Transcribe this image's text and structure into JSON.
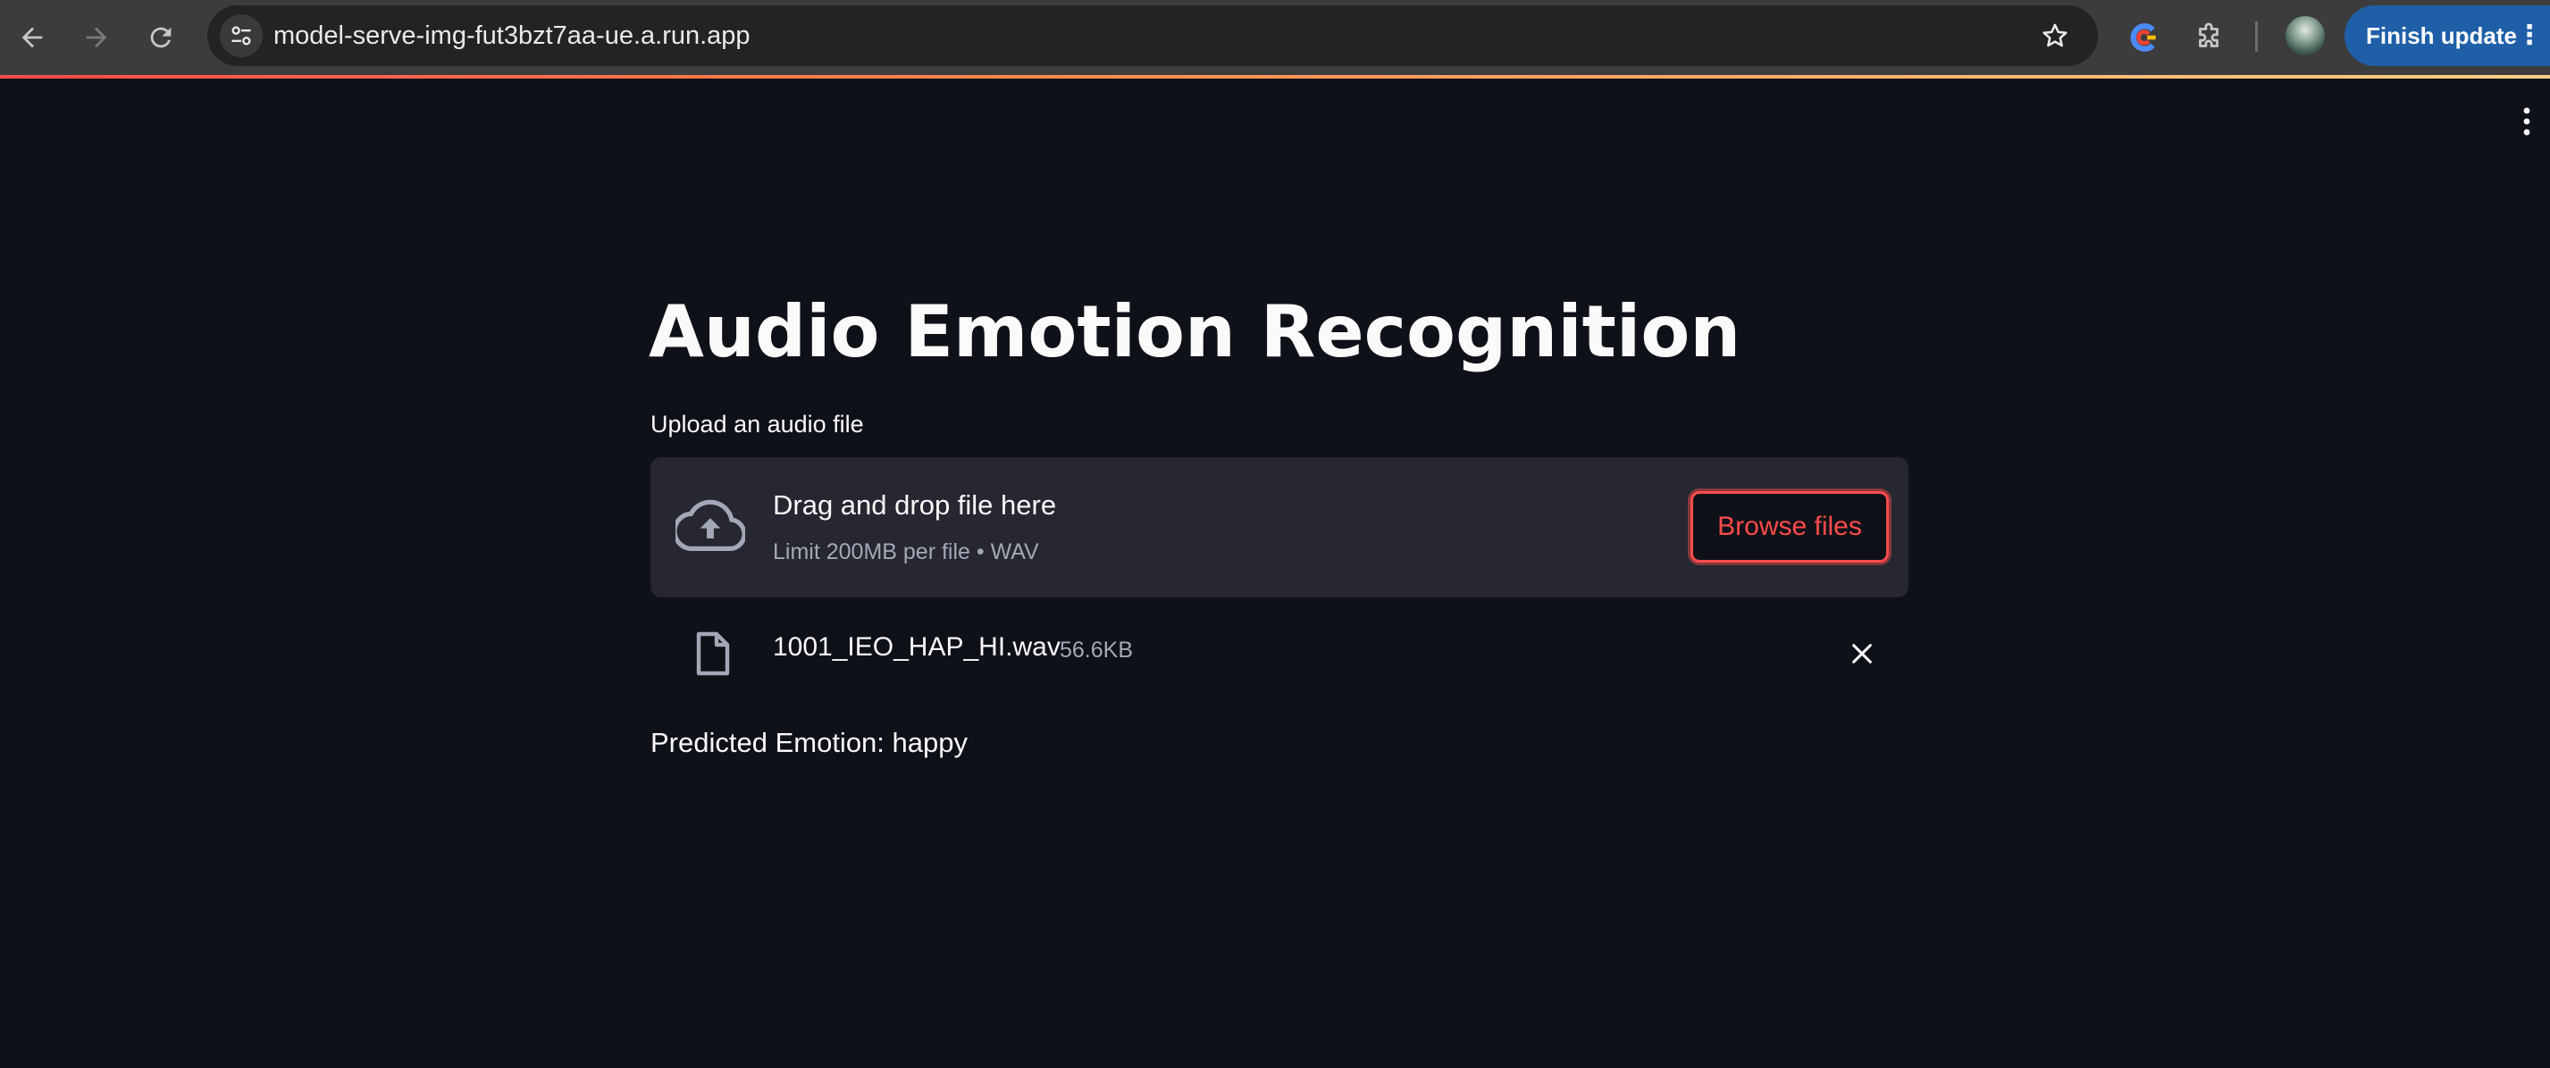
{
  "browser": {
    "url": "model-serve-img-fut3bzt7aa-ue.a.run.app",
    "finish_update_label": "Finish update",
    "icons": {
      "back": "arrow-left-icon",
      "forward": "arrow-right-icon",
      "reload": "reload-icon",
      "site_info": "tune-icon",
      "bookmark": "star-icon",
      "extension_1": "color-extension-icon",
      "extensions": "puzzle-icon",
      "profile": "avatar",
      "menu": "more-vertical-icon"
    }
  },
  "app": {
    "title": "Audio Emotion Recognition",
    "uploader": {
      "label": "Upload an audio file",
      "drop_text": "Drag and drop file here",
      "limit_text": "Limit 200MB per file • WAV",
      "browse_label": "Browse files"
    },
    "uploaded_file": {
      "name": "1001_IEO_HAP_HI.wav",
      "size": "56.6KB"
    },
    "prediction_text": "Predicted Emotion: happy"
  },
  "colors": {
    "background": "#0e1117",
    "dropzone": "#262730",
    "accent": "#ff4b4b",
    "text": "#fafafa",
    "muted_text": "#a3a8b8",
    "chrome_bar": "#3c3c3c",
    "omnibox": "#232323",
    "finish_update": "#1f5fa8"
  }
}
